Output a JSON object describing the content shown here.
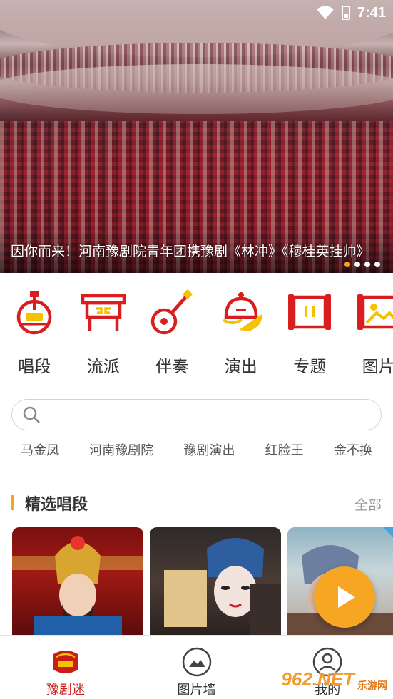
{
  "status_bar": {
    "time": "7:41"
  },
  "banner": {
    "caption": "因你而来！河南豫剧院青年团携豫剧《林冲》《穆桂英挂帅》",
    "dots": 4,
    "active_dot": 0
  },
  "categories": [
    {
      "label": "唱段",
      "icon": "instrument-icon"
    },
    {
      "label": "流派",
      "icon": "table-icon"
    },
    {
      "label": "伴奏",
      "icon": "pipa-icon"
    },
    {
      "label": "演出",
      "icon": "helmet-fan-icon"
    },
    {
      "label": "专题",
      "icon": "scroll-icon"
    },
    {
      "label": "图片",
      "icon": "picture-icon"
    }
  ],
  "search": {
    "placeholder": ""
  },
  "hot_tags": [
    "马金凤",
    "河南豫剧院",
    "豫剧演出",
    "红脸王",
    "金不换"
  ],
  "section": {
    "title": "精选唱段",
    "more": "全部"
  },
  "bottom_nav": [
    {
      "label": "豫剧迷",
      "icon": "yuju-logo-icon",
      "active": true
    },
    {
      "label": "图片墙",
      "icon": "image-wall-icon",
      "active": false
    },
    {
      "label": "我的",
      "icon": "profile-icon",
      "active": false
    }
  ],
  "colors": {
    "accent": "#c81d18",
    "highlight": "#f4a623",
    "icon_red": "#d81e1e",
    "icon_yellow": "#f5c200"
  },
  "watermark": {
    "brand": "962.NET",
    "sub": "乐游网"
  }
}
